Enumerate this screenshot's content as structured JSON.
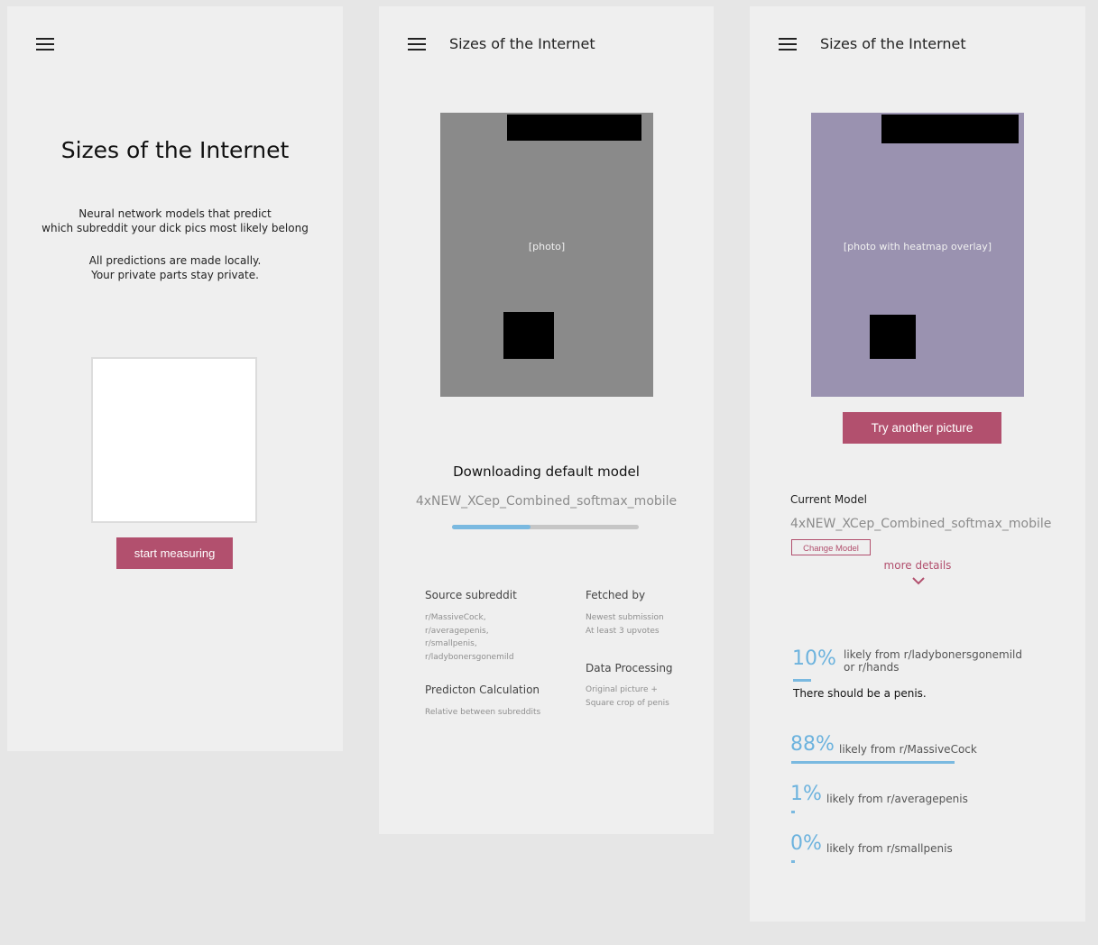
{
  "colors": {
    "accent": "#b2506e",
    "progress": "#7ab9e0",
    "background": "#e6e6e6",
    "panel": "#efefef"
  },
  "screen1": {
    "title": "Sizes of the Internet",
    "desc_line1": "Neural network models that predict",
    "desc_line2": "which subreddit your dick pics most likely belong",
    "privacy_line1": "All predictions are made locally.",
    "privacy_line2": "Your private parts stay private.",
    "start_button": "start measuring"
  },
  "screen2": {
    "app_title": "Sizes of the Internet",
    "photo_note": "[photo]",
    "status": "Downloading default model",
    "model_name": "4xNEW_XCep_Combined_softmax_mobile",
    "progress": 0.42,
    "source_heading": "Source subreddit",
    "source_items": [
      "r/MassiveCock,",
      "r/averagepenis,",
      "r/smallpenis,",
      "r/ladybonersgonemild"
    ],
    "fetched_heading": "Fetched by",
    "fetched_items": [
      "Newest submission",
      "At least 3 upvotes"
    ],
    "prediction_heading": "Predicton Calculation",
    "prediction_items": [
      "Relative between subreddits"
    ],
    "processing_heading": "Data Processing",
    "processing_items": [
      "Original picture +",
      "Square crop of penis"
    ]
  },
  "screen3": {
    "app_title": "Sizes of the Internet",
    "photo_note": "[photo with heatmap overlay]",
    "try_button": "Try another picture",
    "current_model_label": "Current Model",
    "model_name": "4xNEW_XCep_Combined_softmax_mobile",
    "change_model_button": "Change Model",
    "more_details": "more details",
    "check": {
      "percent": "10%",
      "fraction": 0.1,
      "label_line1": "likely from r/ladybonersgonemild",
      "label_line2": "or r/hands",
      "message": "There should be a penis."
    },
    "predictions": [
      {
        "percent": "88%",
        "fraction": 0.88,
        "label": "likely from r/MassiveCock"
      },
      {
        "percent": "1%",
        "fraction": 0.01,
        "label": "likely from r/averagepenis"
      },
      {
        "percent": "0%",
        "fraction": 0.0,
        "label": "likely from r/smallpenis"
      }
    ]
  }
}
